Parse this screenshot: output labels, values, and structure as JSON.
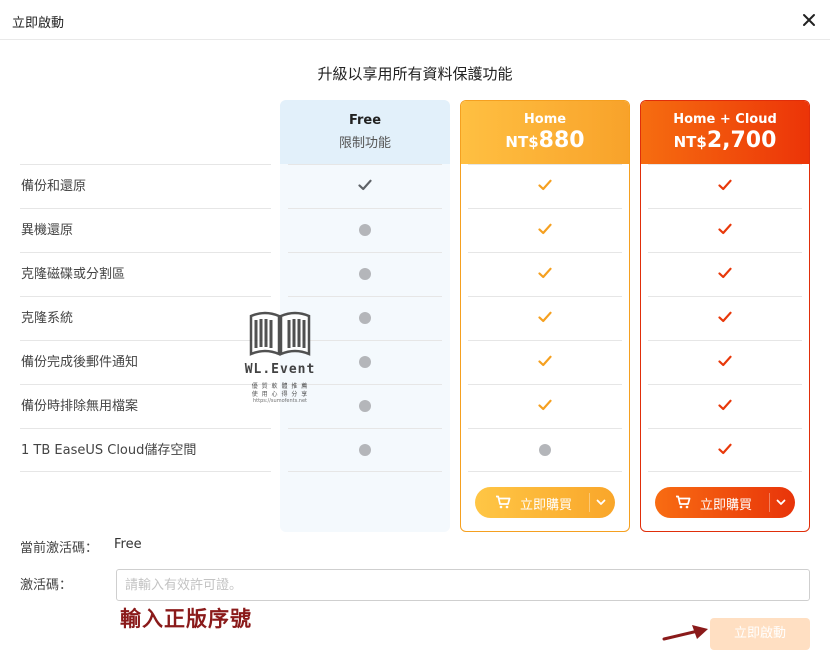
{
  "window": {
    "title": "立即啟動"
  },
  "headline": "升級以享用所有資料保護功能",
  "features": [
    "備份和還原",
    "異機還原",
    "克隆磁碟或分割區",
    "克隆系統",
    "備份完成後郵件通知",
    "備份時排除無用檔案",
    "1 TB EaseUS Cloud儲存空間"
  ],
  "plans": {
    "free": {
      "name": "Free",
      "subtitle": "限制功能",
      "support": [
        "check",
        "dot",
        "dot",
        "dot",
        "dot",
        "dot",
        "dot"
      ]
    },
    "home": {
      "name": "Home",
      "currency": "NT$",
      "price": "880",
      "support": [
        "check",
        "check",
        "check",
        "check",
        "check",
        "check",
        "dot"
      ],
      "buy_label": "立即購買"
    },
    "cloud": {
      "name": "Home + Cloud",
      "currency": "NT$",
      "price": "2,700",
      "support": [
        "check",
        "check",
        "check",
        "check",
        "check",
        "check",
        "check"
      ],
      "buy_label": "立即購買"
    }
  },
  "license": {
    "label": "當前激活碼：",
    "value": "Free"
  },
  "activation": {
    "label": "激活碼：",
    "placeholder": "請輸入有效許可證。",
    "button": "立即啟動"
  },
  "annotation": "輸入正版序號",
  "watermark": {
    "brand": "WL.Event",
    "line1": "優 質 軟 體 推 薦",
    "line2": "使 用 心 得 分 享",
    "url": "https://sumofents.net"
  },
  "colors": {
    "free_check": "#5f6368",
    "home_accent": "#f5a020",
    "cloud_accent": "#e8380a",
    "dot": "#b4b6ba",
    "annotation": "#8a1a1a"
  },
  "icons": {
    "close": "close-icon",
    "check": "check-icon",
    "unsupported": "dot-icon",
    "cart": "cart-icon",
    "dropdown": "chevron-down-icon",
    "arrow": "arrow-icon",
    "watermark": "book-icon"
  }
}
